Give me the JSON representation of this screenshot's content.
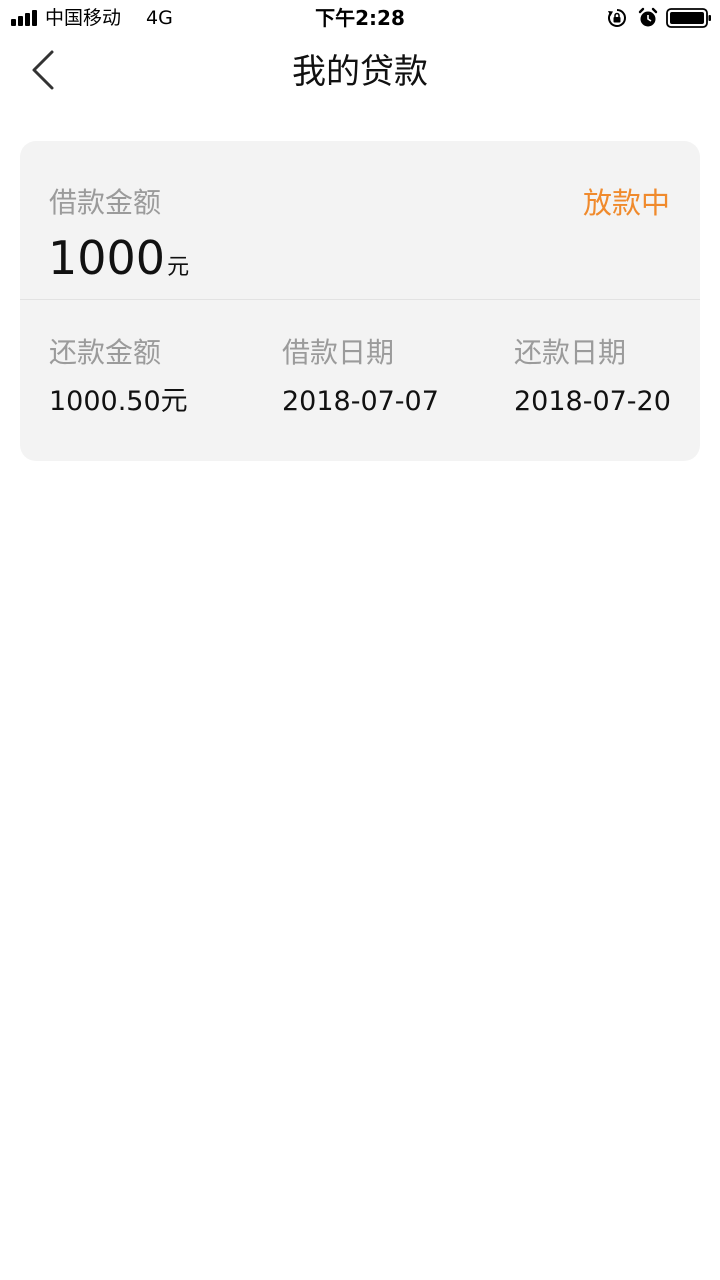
{
  "status_bar": {
    "carrier": "中国移动",
    "network": "4G",
    "time": "下午2:28",
    "icons": [
      "signal-icon",
      "orientation-lock-icon",
      "alarm-icon",
      "battery-icon"
    ]
  },
  "nav": {
    "title": "我的贷款",
    "back_icon": "chevron-left-icon"
  },
  "loan": {
    "amount_label": "借款金额",
    "amount_value": "1000",
    "amount_unit": "元",
    "status": "放款中",
    "repay_amount_label": "还款金额",
    "repay_amount_value": "1000.50元",
    "loan_date_label": "借款日期",
    "loan_date_value": "2018-07-07",
    "repay_date_label": "还款日期",
    "repay_date_value": "2018-07-20"
  },
  "colors": {
    "status_accent": "#f08a2c",
    "card_background": "#f3f3f3",
    "label_gray": "#9b9b9b"
  }
}
